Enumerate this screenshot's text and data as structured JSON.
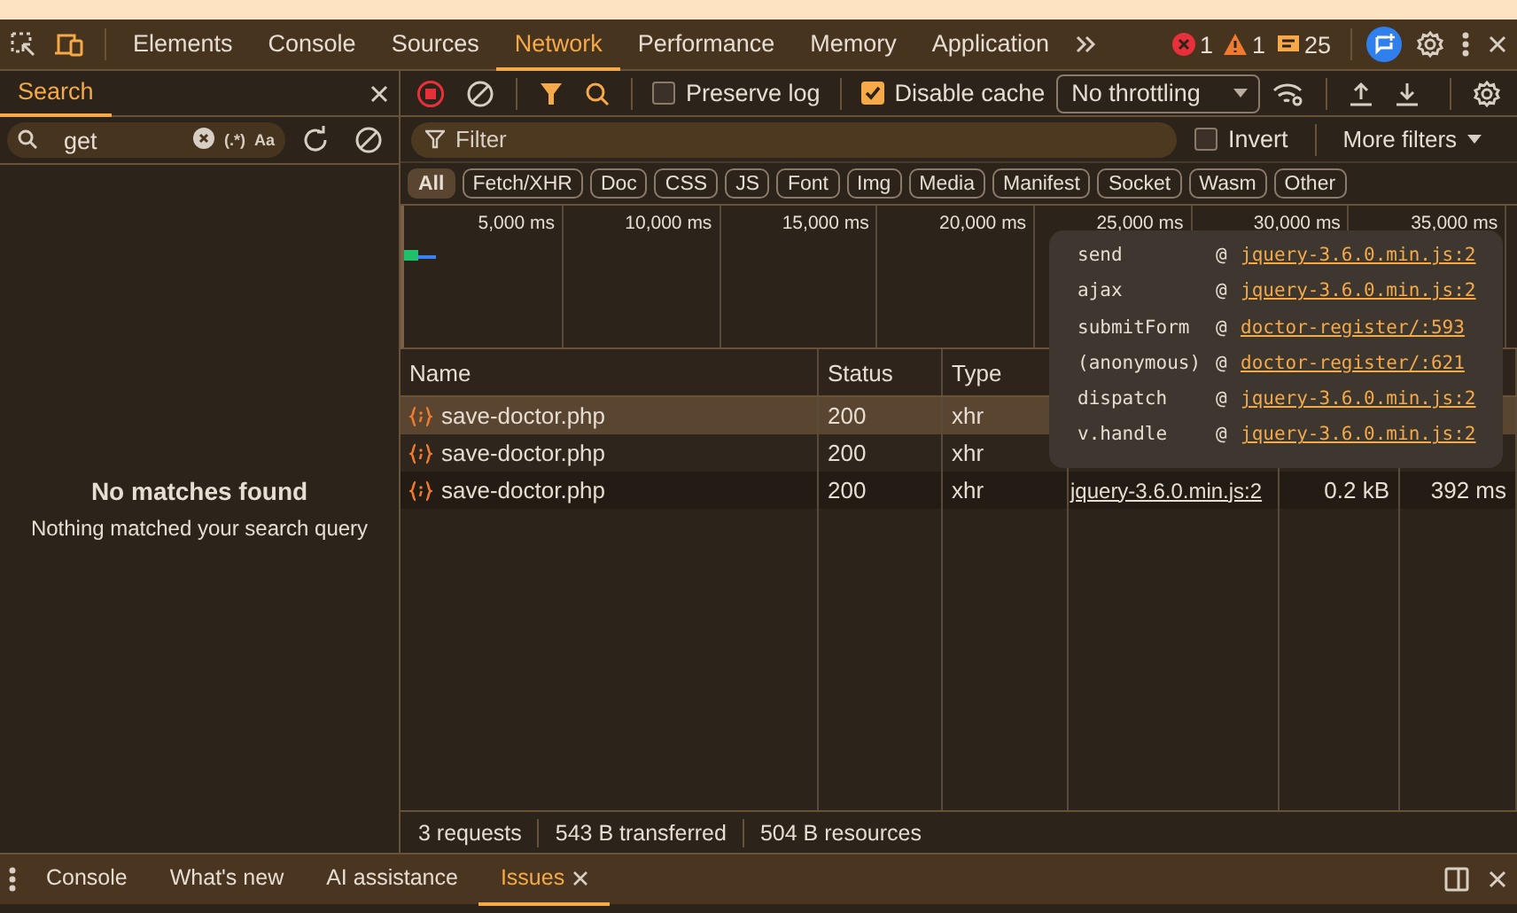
{
  "main_tabs": [
    {
      "label": "Elements",
      "selected": false
    },
    {
      "label": "Console",
      "selected": false
    },
    {
      "label": "Sources",
      "selected": false
    },
    {
      "label": "Network",
      "selected": true
    },
    {
      "label": "Performance",
      "selected": false
    },
    {
      "label": "Memory",
      "selected": false
    },
    {
      "label": "Application",
      "selected": false
    }
  ],
  "counters": [
    {
      "kind": "error",
      "count": "1"
    },
    {
      "kind": "warning",
      "count": "1"
    },
    {
      "kind": "message",
      "count": "25"
    }
  ],
  "search_panel": {
    "tab": {
      "label": "Search",
      "selected": true
    },
    "query": "get",
    "regex": "(.*)",
    "match_case": "Aa",
    "empty_title": "No matches found",
    "empty_text": "Nothing matched your search query"
  },
  "toolbar": {
    "recording": true,
    "preserve_log": {
      "label": "Preserve log",
      "checked": false
    },
    "disable_cache": {
      "label": "Disable cache",
      "checked": true
    },
    "throttling": "No throttling"
  },
  "filter": {
    "placeholder": "Filter",
    "invert": {
      "label": "Invert",
      "checked": false
    },
    "more_filters": "More filters"
  },
  "type_filters": [
    {
      "label": "All",
      "selected": true
    },
    {
      "label": "Fetch/XHR",
      "selected": false
    },
    {
      "label": "Doc",
      "selected": false
    },
    {
      "label": "CSS",
      "selected": false
    },
    {
      "label": "JS",
      "selected": false
    },
    {
      "label": "Font",
      "selected": false
    },
    {
      "label": "Img",
      "selected": false
    },
    {
      "label": "Media",
      "selected": false
    },
    {
      "label": "Manifest",
      "selected": false
    },
    {
      "label": "Socket",
      "selected": false
    },
    {
      "label": "Wasm",
      "selected": false
    },
    {
      "label": "Other",
      "selected": false
    }
  ],
  "overview": {
    "ticks": [
      "5,000 ms",
      "10,000 ms",
      "15,000 ms",
      "20,000 ms",
      "25,000 ms",
      "30,000 ms",
      "35,000 ms"
    ]
  },
  "table": {
    "columns": [
      "Name",
      "Status",
      "Type"
    ],
    "rows": [
      {
        "name": "save-doctor.php",
        "status": "200",
        "type": "xhr",
        "selected": true
      },
      {
        "name": "save-doctor.php",
        "status": "200",
        "type": "xhr",
        "selected": false
      },
      {
        "name": "save-doctor.php",
        "status": "200",
        "type": "xhr",
        "initiator": "jquery-3.6.0.min.js:2",
        "size": "0.2 kB",
        "time": "392 ms",
        "selected": false
      }
    ]
  },
  "tooltip": {
    "frames": [
      {
        "function": "send",
        "at": "@",
        "location": "jquery-3.6.0.min.js:2"
      },
      {
        "function": "ajax",
        "at": "@",
        "location": "jquery-3.6.0.min.js:2"
      },
      {
        "function": "submitForm",
        "at": "@",
        "location": "doctor-register/:593"
      },
      {
        "function": "(anonymous)",
        "at": "@",
        "location": "doctor-register/:621"
      },
      {
        "function": "dispatch",
        "at": "@",
        "location": "jquery-3.6.0.min.js:2"
      },
      {
        "function": "v.handle",
        "at": "@",
        "location": "jquery-3.6.0.min.js:2"
      }
    ]
  },
  "status_bar": [
    "3 requests",
    "543 B transferred",
    "504 B resources"
  ],
  "drawer": {
    "tabs": [
      {
        "label": "Console",
        "selected": false,
        "closable": false
      },
      {
        "label": "What's new",
        "selected": false,
        "closable": false
      },
      {
        "label": "AI assistance",
        "selected": false,
        "closable": false
      },
      {
        "label": "Issues",
        "selected": true,
        "closable": true
      }
    ]
  }
}
